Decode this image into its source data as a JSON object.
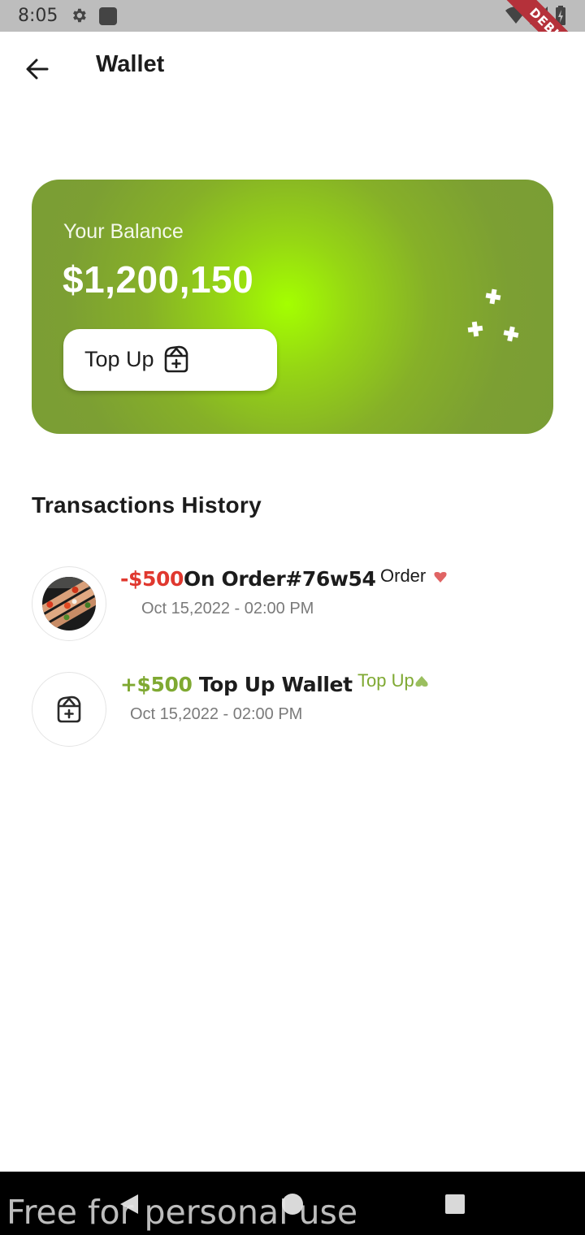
{
  "status_bar": {
    "time": "8:05",
    "debug_label": "DEBUG"
  },
  "app_bar": {
    "title": "Wallet"
  },
  "balance_card": {
    "label": "Your Balance",
    "amount": "$1,200,150",
    "topup_label": "Top Up",
    "accent_color": "#a4ff00",
    "card_color": "#7a9d35"
  },
  "transactions": {
    "title": "Transactions History",
    "items": [
      {
        "amount": "-$500",
        "description": "On Order#76w54",
        "date": "Oct 15,2022 - 02:00 PM",
        "tag": "Order",
        "tag_icon": "heart-down-icon",
        "amount_color": "#e0382f"
      },
      {
        "amount": "+$500",
        "description": " Top Up Wallet",
        "date": "Oct 15,2022 - 02:00 PM",
        "tag": "Top Up",
        "tag_icon": "heart-up-icon",
        "amount_color": "#7fa932"
      }
    ]
  },
  "watermark": "Free for personal use"
}
